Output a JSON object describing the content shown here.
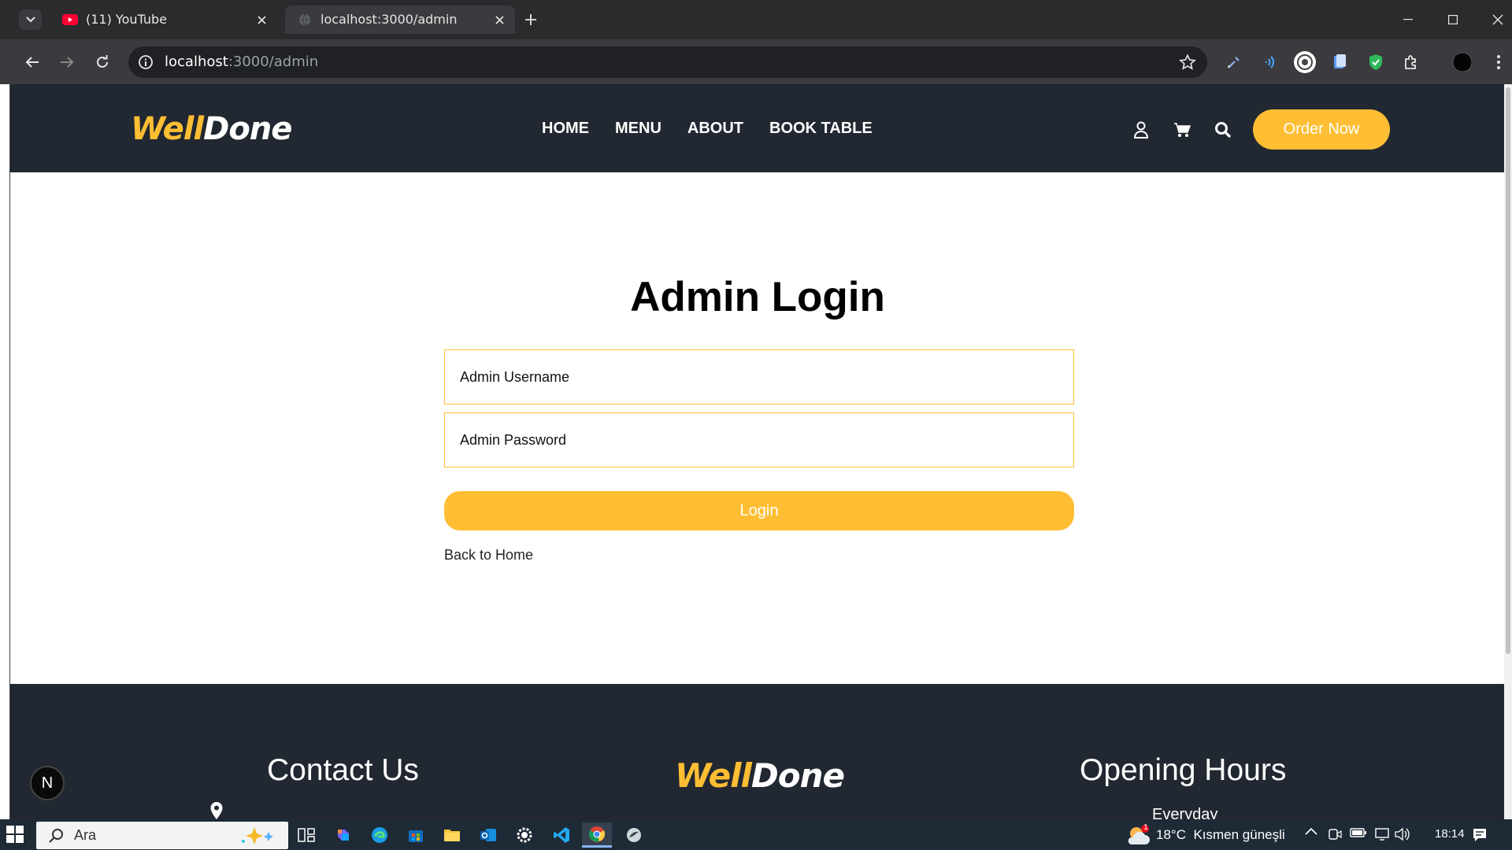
{
  "browser": {
    "tabs": [
      {
        "title": "(11) YouTube",
        "favicon": "youtube-icon",
        "active": false
      },
      {
        "title": "localhost:3000/admin",
        "favicon": "globe-icon",
        "active": true
      }
    ],
    "url_host": "localhost",
    "url_path": ":3000/admin"
  },
  "site": {
    "logo_part1": "Well",
    "logo_part2": "Done",
    "nav": [
      "HOME",
      "MENU",
      "ABOUT",
      "BOOK TABLE"
    ],
    "order_button": "Order Now"
  },
  "login": {
    "title": "Admin Login",
    "username_placeholder": "Admin Username",
    "password_placeholder": "Admin Password",
    "submit_label": "Login",
    "back_link": "Back to Home"
  },
  "footer": {
    "contact_title": "Contact Us",
    "hours_title": "Opening Hours",
    "hours_day": "Everyday"
  },
  "next_badge": "N",
  "taskbar": {
    "search_placeholder": "Ara",
    "weather_temp": "18°C",
    "weather_desc": "Kısmen güneşli",
    "weather_badge": "1",
    "clock": "18:14"
  },
  "colors": {
    "accent": "#ffbe33",
    "header_bg": "#222831",
    "browser_bg": "#2b2b2e"
  }
}
